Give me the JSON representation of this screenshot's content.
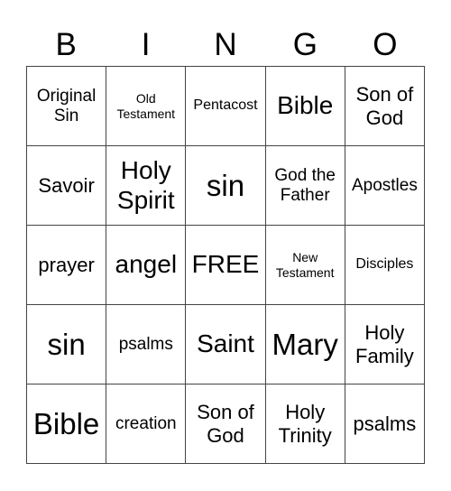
{
  "header": [
    "B",
    "I",
    "N",
    "G",
    "O"
  ],
  "cells": [
    {
      "text": "Original Sin",
      "size": "s-md"
    },
    {
      "text": "Old Testament",
      "size": "s-xs"
    },
    {
      "text": "Pentacost",
      "size": "s-sm"
    },
    {
      "text": "Bible",
      "size": "s-xl"
    },
    {
      "text": "Son of God",
      "size": "s-lg"
    },
    {
      "text": "Savoir",
      "size": "s-lg"
    },
    {
      "text": "Holy Spirit",
      "size": "s-xl"
    },
    {
      "text": "sin",
      "size": "s-xxl"
    },
    {
      "text": "God the Father",
      "size": "s-md"
    },
    {
      "text": "Apostles",
      "size": "s-md"
    },
    {
      "text": "prayer",
      "size": "s-lg"
    },
    {
      "text": "angel",
      "size": "s-xl"
    },
    {
      "text": "FREE",
      "size": "s-xl"
    },
    {
      "text": "New Testament",
      "size": "s-xs"
    },
    {
      "text": "Disciples",
      "size": "s-sm"
    },
    {
      "text": "sin",
      "size": "s-xxl"
    },
    {
      "text": "psalms",
      "size": "s-md"
    },
    {
      "text": "Saint",
      "size": "s-xl"
    },
    {
      "text": "Mary",
      "size": "s-xxl"
    },
    {
      "text": "Holy Family",
      "size": "s-lg"
    },
    {
      "text": "Bible",
      "size": "s-xxl"
    },
    {
      "text": "creation",
      "size": "s-md"
    },
    {
      "text": "Son of God",
      "size": "s-lg"
    },
    {
      "text": "Holy Trinity",
      "size": "s-lg"
    },
    {
      "text": "psalms",
      "size": "s-lg"
    }
  ]
}
